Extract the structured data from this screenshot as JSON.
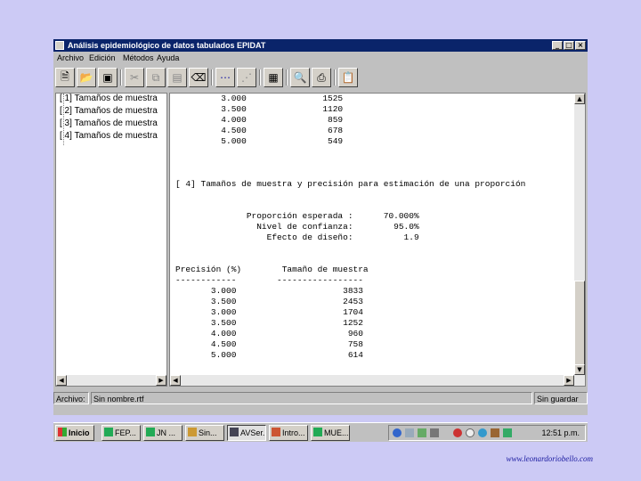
{
  "window": {
    "title": "Análisis epidemiológico de datos tabulados EPIDAT",
    "controls": {
      "minimize": "_",
      "maximize": "□",
      "close": "×"
    }
  },
  "menu": [
    "Archivo",
    "Edición",
    "Métodos",
    "Ayuda"
  ],
  "toolbar": {
    "icons": [
      "new-document-icon",
      "open-folder-icon",
      "save-disk-icon",
      "cut-icon",
      "copy-icon",
      "paste-icon",
      "eraser-icon",
      "link-icon",
      "unlink-icon",
      "calculator-icon",
      "preview-icon",
      "printer-icon",
      "report-icon"
    ]
  },
  "tree": {
    "items": [
      "[ 1] Tamaños de muestra",
      "[ 2] Tamaños de muestra",
      "[ 3] Tamaños de muestra",
      "[ 4] Tamaños de muestra"
    ]
  },
  "output": {
    "text": "         3.000               1525\n         3.500               1120\n         4.000                859\n         4.500                678\n         5.000                549\n\n\n\n[ 4] Tamaños de muestra y precisión para estimación de una proporción\n\n\n              Proporción esperada :      70.000%\n                Nivel de confianza:        95.0%\n                  Efecto de diseño:          1.9\n\n\nPrecisión (%)        Tamaño de muestra\n------------        -----------------\n       3.000                     3833\n       3.500                     2453\n       3.000                     1704\n       3.500                     1252\n       4.000                      960\n       4.500                      758\n       5.000                      614"
  },
  "status": {
    "label": "Archivo:",
    "filename": "Sin nombre.rtf",
    "state": "Sin guardar"
  },
  "taskbar": {
    "start": "Inicio",
    "tasks": [
      "FEP...",
      "JN ...",
      "Sin...",
      "AVSer...",
      "Intro...",
      "MUE..."
    ],
    "active_index": 3,
    "clock": "12:51 p.m."
  },
  "footer": "www.leonardoriobello.com"
}
